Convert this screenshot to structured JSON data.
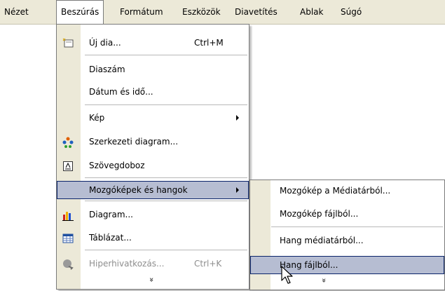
{
  "menubar": {
    "items": [
      {
        "label": "Nézet"
      },
      {
        "label": "Beszúrás"
      },
      {
        "label": "Formátum"
      },
      {
        "label": "Eszközök"
      },
      {
        "label": "Diavetítés"
      },
      {
        "label": "Ablak"
      },
      {
        "label": "Súgó"
      }
    ]
  },
  "menu": {
    "new_slide": {
      "label": "Új dia...",
      "shortcut": "Ctrl+M"
    },
    "slide_number": {
      "label": "Diaszám"
    },
    "date_time": {
      "label": "Dátum és idő..."
    },
    "picture": {
      "label": "Kép"
    },
    "org_chart": {
      "label": "Szerkezeti diagram..."
    },
    "text_box": {
      "label": "Szövegdoboz"
    },
    "movies_sounds": {
      "label": "Mozgóképek és hangok"
    },
    "chart": {
      "label": "Diagram..."
    },
    "table": {
      "label": "Táblázat..."
    },
    "hyperlink": {
      "label": "Hiperhivatkozás...",
      "shortcut": "Ctrl+K"
    },
    "expand": "»"
  },
  "submenu": {
    "movie_gallery": {
      "label": "Mozgókép a Médiatárból..."
    },
    "movie_file": {
      "label": "Mozgókép fájlból..."
    },
    "sound_gallery": {
      "label": "Hang médiatárból..."
    },
    "sound_file": {
      "label": "Hang fájlból..."
    },
    "expand": "»"
  },
  "colors": {
    "menu_bg": "#ECE9D8",
    "highlight": "#B6BDD2",
    "highlight_border": "#0A246A"
  }
}
